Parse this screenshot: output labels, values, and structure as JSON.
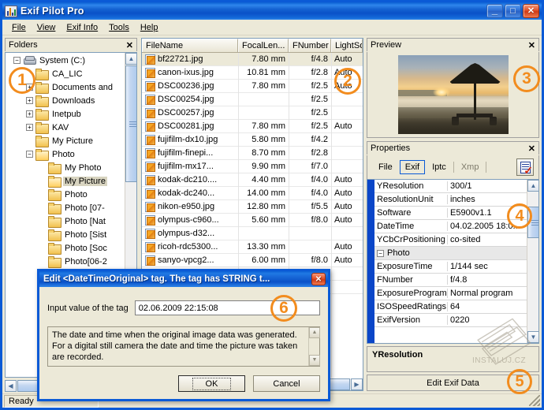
{
  "window": {
    "title": "Exif Pilot Pro",
    "app_icon": "app-image-icon",
    "minimize_glyph": "_",
    "maximize_glyph": "□",
    "close_glyph": "✕"
  },
  "menubar": {
    "items": [
      {
        "label": "File"
      },
      {
        "label": "View"
      },
      {
        "label": "Exif Info"
      },
      {
        "label": "Tools"
      },
      {
        "label": "Help"
      }
    ]
  },
  "folders_panel": {
    "title": "Folders",
    "close_glyph": "✕",
    "tree": [
      {
        "label": "System (C:)",
        "depth": 0,
        "icon": "drive",
        "expander": "−",
        "selected": false
      },
      {
        "label": "CA_LIC",
        "depth": 1,
        "icon": "folder",
        "expander": "",
        "selected": false
      },
      {
        "label": "Documents and",
        "depth": 1,
        "icon": "folder",
        "expander": "+",
        "selected": false
      },
      {
        "label": "Downloads",
        "depth": 1,
        "icon": "folder",
        "expander": "+",
        "selected": false
      },
      {
        "label": "Inetpub",
        "depth": 1,
        "icon": "folder",
        "expander": "+",
        "selected": false
      },
      {
        "label": "KAV",
        "depth": 1,
        "icon": "folder",
        "expander": "+",
        "selected": false
      },
      {
        "label": "My Picture",
        "depth": 1,
        "icon": "folder",
        "expander": "",
        "selected": false
      },
      {
        "label": "Photo",
        "depth": 1,
        "icon": "folder-open",
        "expander": "−",
        "selected": false
      },
      {
        "label": "My Photo",
        "depth": 2,
        "icon": "folder",
        "expander": "",
        "selected": false
      },
      {
        "label": "My Picture",
        "depth": 2,
        "icon": "folder-open",
        "expander": "",
        "selected": true
      },
      {
        "label": "Photo",
        "depth": 2,
        "icon": "folder",
        "expander": "",
        "selected": false
      },
      {
        "label": "Photo [07-",
        "depth": 2,
        "icon": "folder",
        "expander": "",
        "selected": false
      },
      {
        "label": "Photo [Nat",
        "depth": 2,
        "icon": "folder",
        "expander": "",
        "selected": false
      },
      {
        "label": "Photo [Sist",
        "depth": 2,
        "icon": "folder",
        "expander": "",
        "selected": false
      },
      {
        "label": "Photo [Soc",
        "depth": 2,
        "icon": "folder",
        "expander": "",
        "selected": false
      },
      {
        "label": "Photo[06-2",
        "depth": 2,
        "icon": "folder",
        "expander": "",
        "selected": false
      }
    ],
    "scroll_up_glyph": "▲",
    "scroll_down_glyph": "▼",
    "hscroll_left_glyph": "◀",
    "hscroll_right_glyph": "▶"
  },
  "file_list": {
    "columns": [
      "FileName",
      "FocalLen...",
      "FNumber",
      "LightSource"
    ],
    "rows": [
      {
        "name": "bf22721.jpg",
        "focal": "7.80 mm",
        "fnumber": "f/4.8",
        "light": "Auto",
        "selected": true
      },
      {
        "name": "canon-ixus.jpg",
        "focal": "10.81 mm",
        "fnumber": "f/2.8",
        "light": "Auto",
        "selected": false
      },
      {
        "name": "DSC00236.jpg",
        "focal": "7.80 mm",
        "fnumber": "f/2.5",
        "light": "Auto",
        "selected": false
      },
      {
        "name": "DSC00254.jpg",
        "focal": "",
        "fnumber": "f/2.5",
        "light": "",
        "selected": false
      },
      {
        "name": "DSC00257.jpg",
        "focal": "",
        "fnumber": "f/2.5",
        "light": "",
        "selected": false
      },
      {
        "name": "DSC00281.jpg",
        "focal": "7.80 mm",
        "fnumber": "f/2.5",
        "light": "Auto",
        "selected": false
      },
      {
        "name": "fujifilm-dx10.jpg",
        "focal": "5.80 mm",
        "fnumber": "f/4.2",
        "light": "",
        "selected": false
      },
      {
        "name": "fujifilm-finepi...",
        "focal": "8.70 mm",
        "fnumber": "f/2.8",
        "light": "",
        "selected": false
      },
      {
        "name": "fujifilm-mx17...",
        "focal": "9.90 mm",
        "fnumber": "f/7.0",
        "light": "",
        "selected": false
      },
      {
        "name": "kodak-dc210....",
        "focal": "4.40 mm",
        "fnumber": "f/4.0",
        "light": "Auto",
        "selected": false
      },
      {
        "name": "kodak-dc240...",
        "focal": "14.00 mm",
        "fnumber": "f/4.0",
        "light": "Auto",
        "selected": false
      },
      {
        "name": "nikon-e950.jpg",
        "focal": "12.80 mm",
        "fnumber": "f/5.5",
        "light": "Auto",
        "selected": false
      },
      {
        "name": "olympus-c960...",
        "focal": "5.60 mm",
        "fnumber": "f/8.0",
        "light": "Auto",
        "selected": false
      },
      {
        "name": "olympus-d32...",
        "focal": "",
        "fnumber": "",
        "light": "",
        "selected": false
      },
      {
        "name": "ricoh-rdc5300...",
        "focal": "13.30 mm",
        "fnumber": "",
        "light": "Auto",
        "selected": false
      },
      {
        "name": "sanyo-vpcg2...",
        "focal": "6.00 mm",
        "fnumber": "f/8.0",
        "light": "Auto",
        "selected": false
      },
      {
        "name": "",
        "focal": "",
        "fnumber": "",
        "light": "",
        "selected": false
      },
      {
        "name": "",
        "focal": "",
        "fnumber": "",
        "light": "",
        "selected": false
      }
    ]
  },
  "preview_panel": {
    "title": "Preview",
    "close_glyph": "✕",
    "image_alt": "sunset-beach-umbrella-photo"
  },
  "properties_panel": {
    "title": "Properties",
    "close_glyph": "✕",
    "tabs": [
      {
        "label": "File",
        "active": false,
        "dim": false
      },
      {
        "label": "Exif",
        "active": true,
        "dim": false
      },
      {
        "label": "Iptc",
        "active": false,
        "dim": false
      },
      {
        "label": "Xmp",
        "active": false,
        "dim": true
      }
    ],
    "toolbar_button": "edit-tags-icon",
    "rows": [
      {
        "key": "YResolution",
        "value": "300/1",
        "group": false
      },
      {
        "key": "ResolutionUnit",
        "value": "inches",
        "group": false
      },
      {
        "key": "Software",
        "value": "E5900v1.1",
        "group": false
      },
      {
        "key": "DateTime",
        "value": "04.02.2005 18:0...",
        "group": false
      },
      {
        "key": "YCbCrPositioning",
        "value": "co-sited",
        "group": false
      },
      {
        "key": "Photo",
        "value": "",
        "group": true,
        "expander": "−"
      },
      {
        "key": "ExposureTime",
        "value": "1/144 sec",
        "group": false
      },
      {
        "key": "FNumber",
        "value": "f/4.8",
        "group": false
      },
      {
        "key": "ExposureProgram",
        "value": "Normal program",
        "group": false
      },
      {
        "key": "ISOSpeedRatings",
        "value": "64",
        "group": false
      },
      {
        "key": "ExifVersion",
        "value": "0220",
        "group": false
      }
    ],
    "selected_tag": "YResolution",
    "edit_button": "Edit Exif Data",
    "scroll_up_glyph": "▲",
    "scroll_down_glyph": "▼"
  },
  "dialog": {
    "title": "Edit <DateTimeOriginal> tag. The tag has STRING t...",
    "close_glyph": "✕",
    "input_label": "Input value of the tag",
    "input_value": "02.06.2009 22:15:08",
    "description": "The date and time when the original image data was generated. For a digital still camera the date and time the picture was taken are recorded.",
    "ok_label": "OK",
    "cancel_label": "Cancel",
    "scroll_up_glyph": "▲",
    "scroll_down_glyph": "▼"
  },
  "statusbar": {
    "text": "Ready"
  },
  "watermark": {
    "text": "INSTALUJ.CZ"
  },
  "markers": [
    {
      "id": "1",
      "target": "folders-panel"
    },
    {
      "id": "2",
      "target": "file-list"
    },
    {
      "id": "3",
      "target": "preview-panel"
    },
    {
      "id": "4",
      "target": "properties-grid"
    },
    {
      "id": "5",
      "target": "edit-exif-data-button"
    },
    {
      "id": "6",
      "target": "dialog-input"
    }
  ],
  "colors": {
    "accent_marker": "#f28c1e",
    "titlebar_blue": "#0a5ad6",
    "chrome": "#ece9d8",
    "selection": "#d8d4c0",
    "grid_bar": "#0a46c8"
  }
}
